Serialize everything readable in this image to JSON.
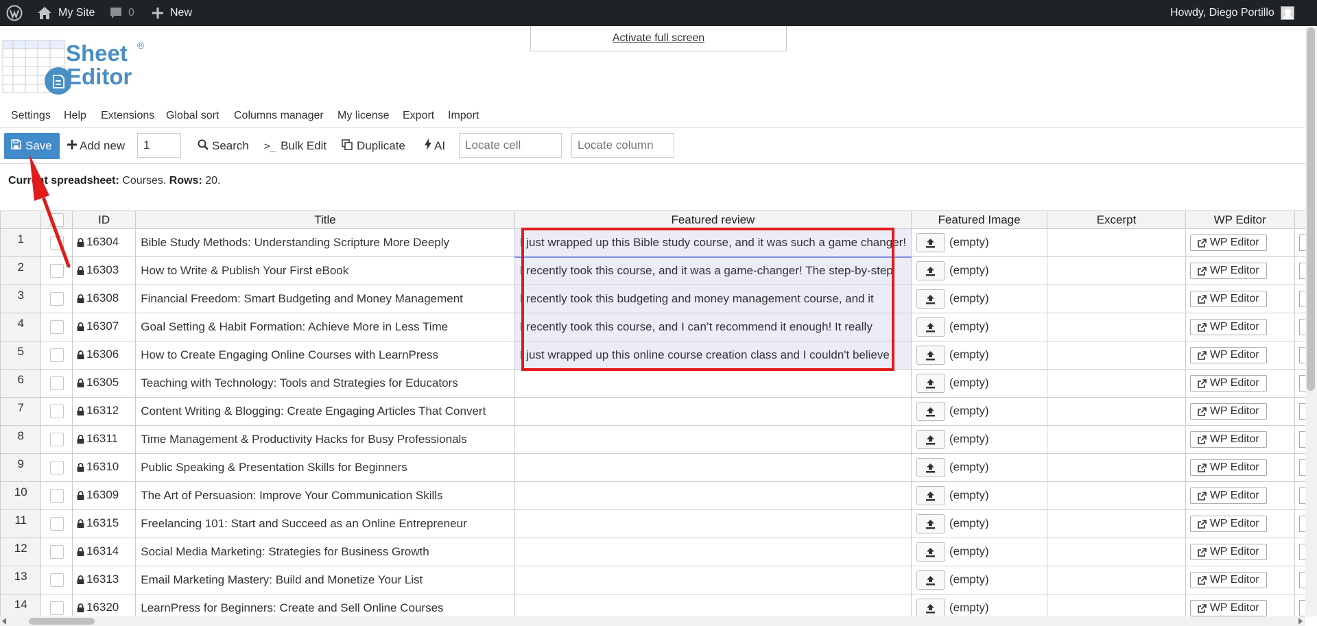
{
  "adminbar": {
    "site_name": "My Site",
    "comments_count": "0",
    "new_label": "New",
    "howdy": "Howdy, Diego Portillo"
  },
  "fullscreen_label": "Activate full screen",
  "logo": {
    "line1": "Sheet",
    "line2": "Editor",
    "reg": "®"
  },
  "menu": [
    "Settings",
    "Help",
    "Extensions",
    "Global sort",
    "Columns manager",
    "My license",
    "Export",
    "Import"
  ],
  "toolbar": {
    "save": "Save",
    "add_new": "Add new",
    "add_count": "1",
    "search": "Search",
    "bulk_edit": "Bulk Edit",
    "duplicate": "Duplicate",
    "ai": "AI",
    "locate_cell_placeholder": "Locate cell",
    "locate_column_placeholder": "Locate column"
  },
  "info": {
    "label": "Current spreadsheet:",
    "sheet": "Courses.",
    "rows_label": "Rows:",
    "rows": "20."
  },
  "columns": [
    "ID",
    "Title",
    "Featured review",
    "Featured Image",
    "Excerpt",
    "WP Editor"
  ],
  "wp_editor_label": "WP Editor",
  "empty_label": "(empty)",
  "rows": [
    {
      "n": "1",
      "id": "16304",
      "title": "Bible Study Methods: Understanding Scripture More Deeply",
      "review": "I just wrapped up this Bible study course, and it was such a game changer!"
    },
    {
      "n": "2",
      "id": "16303",
      "title": "How to Write & Publish Your First eBook",
      "review": "I recently took this course, and it was a game-changer! The step-by-step"
    },
    {
      "n": "3",
      "id": "16308",
      "title": "Financial Freedom: Smart Budgeting and Money Management",
      "review": "I recently took this budgeting and money management course, and it"
    },
    {
      "n": "4",
      "id": "16307",
      "title": "Goal Setting & Habit Formation: Achieve More in Less Time",
      "review": "I recently took this course, and I can’t recommend it enough! It really"
    },
    {
      "n": "5",
      "id": "16306",
      "title": "How to Create Engaging Online Courses with LearnPress",
      "review": "I just wrapped up this online course creation class and I couldn't believe"
    },
    {
      "n": "6",
      "id": "16305",
      "title": "Teaching with Technology: Tools and Strategies for Educators",
      "review": ""
    },
    {
      "n": "7",
      "id": "16312",
      "title": "Content Writing & Blogging: Create Engaging Articles That Convert",
      "review": ""
    },
    {
      "n": "8",
      "id": "16311",
      "title": "Time Management & Productivity Hacks for Busy Professionals",
      "review": ""
    },
    {
      "n": "9",
      "id": "16310",
      "title": "Public Speaking & Presentation Skills for Beginners",
      "review": ""
    },
    {
      "n": "10",
      "id": "16309",
      "title": "The Art of Persuasion: Improve Your Communication Skills",
      "review": ""
    },
    {
      "n": "11",
      "id": "16315",
      "title": "Freelancing 101: Start and Succeed as an Online Entrepreneur",
      "review": ""
    },
    {
      "n": "12",
      "id": "16314",
      "title": "Social Media Marketing: Strategies for Business Growth",
      "review": ""
    },
    {
      "n": "13",
      "id": "16313",
      "title": "Email Marketing Mastery: Build and Monetize Your List",
      "review": ""
    },
    {
      "n": "14",
      "id": "16320",
      "title": "LearnPress for Beginners: Create and Sell Online Courses",
      "review": ""
    }
  ]
}
